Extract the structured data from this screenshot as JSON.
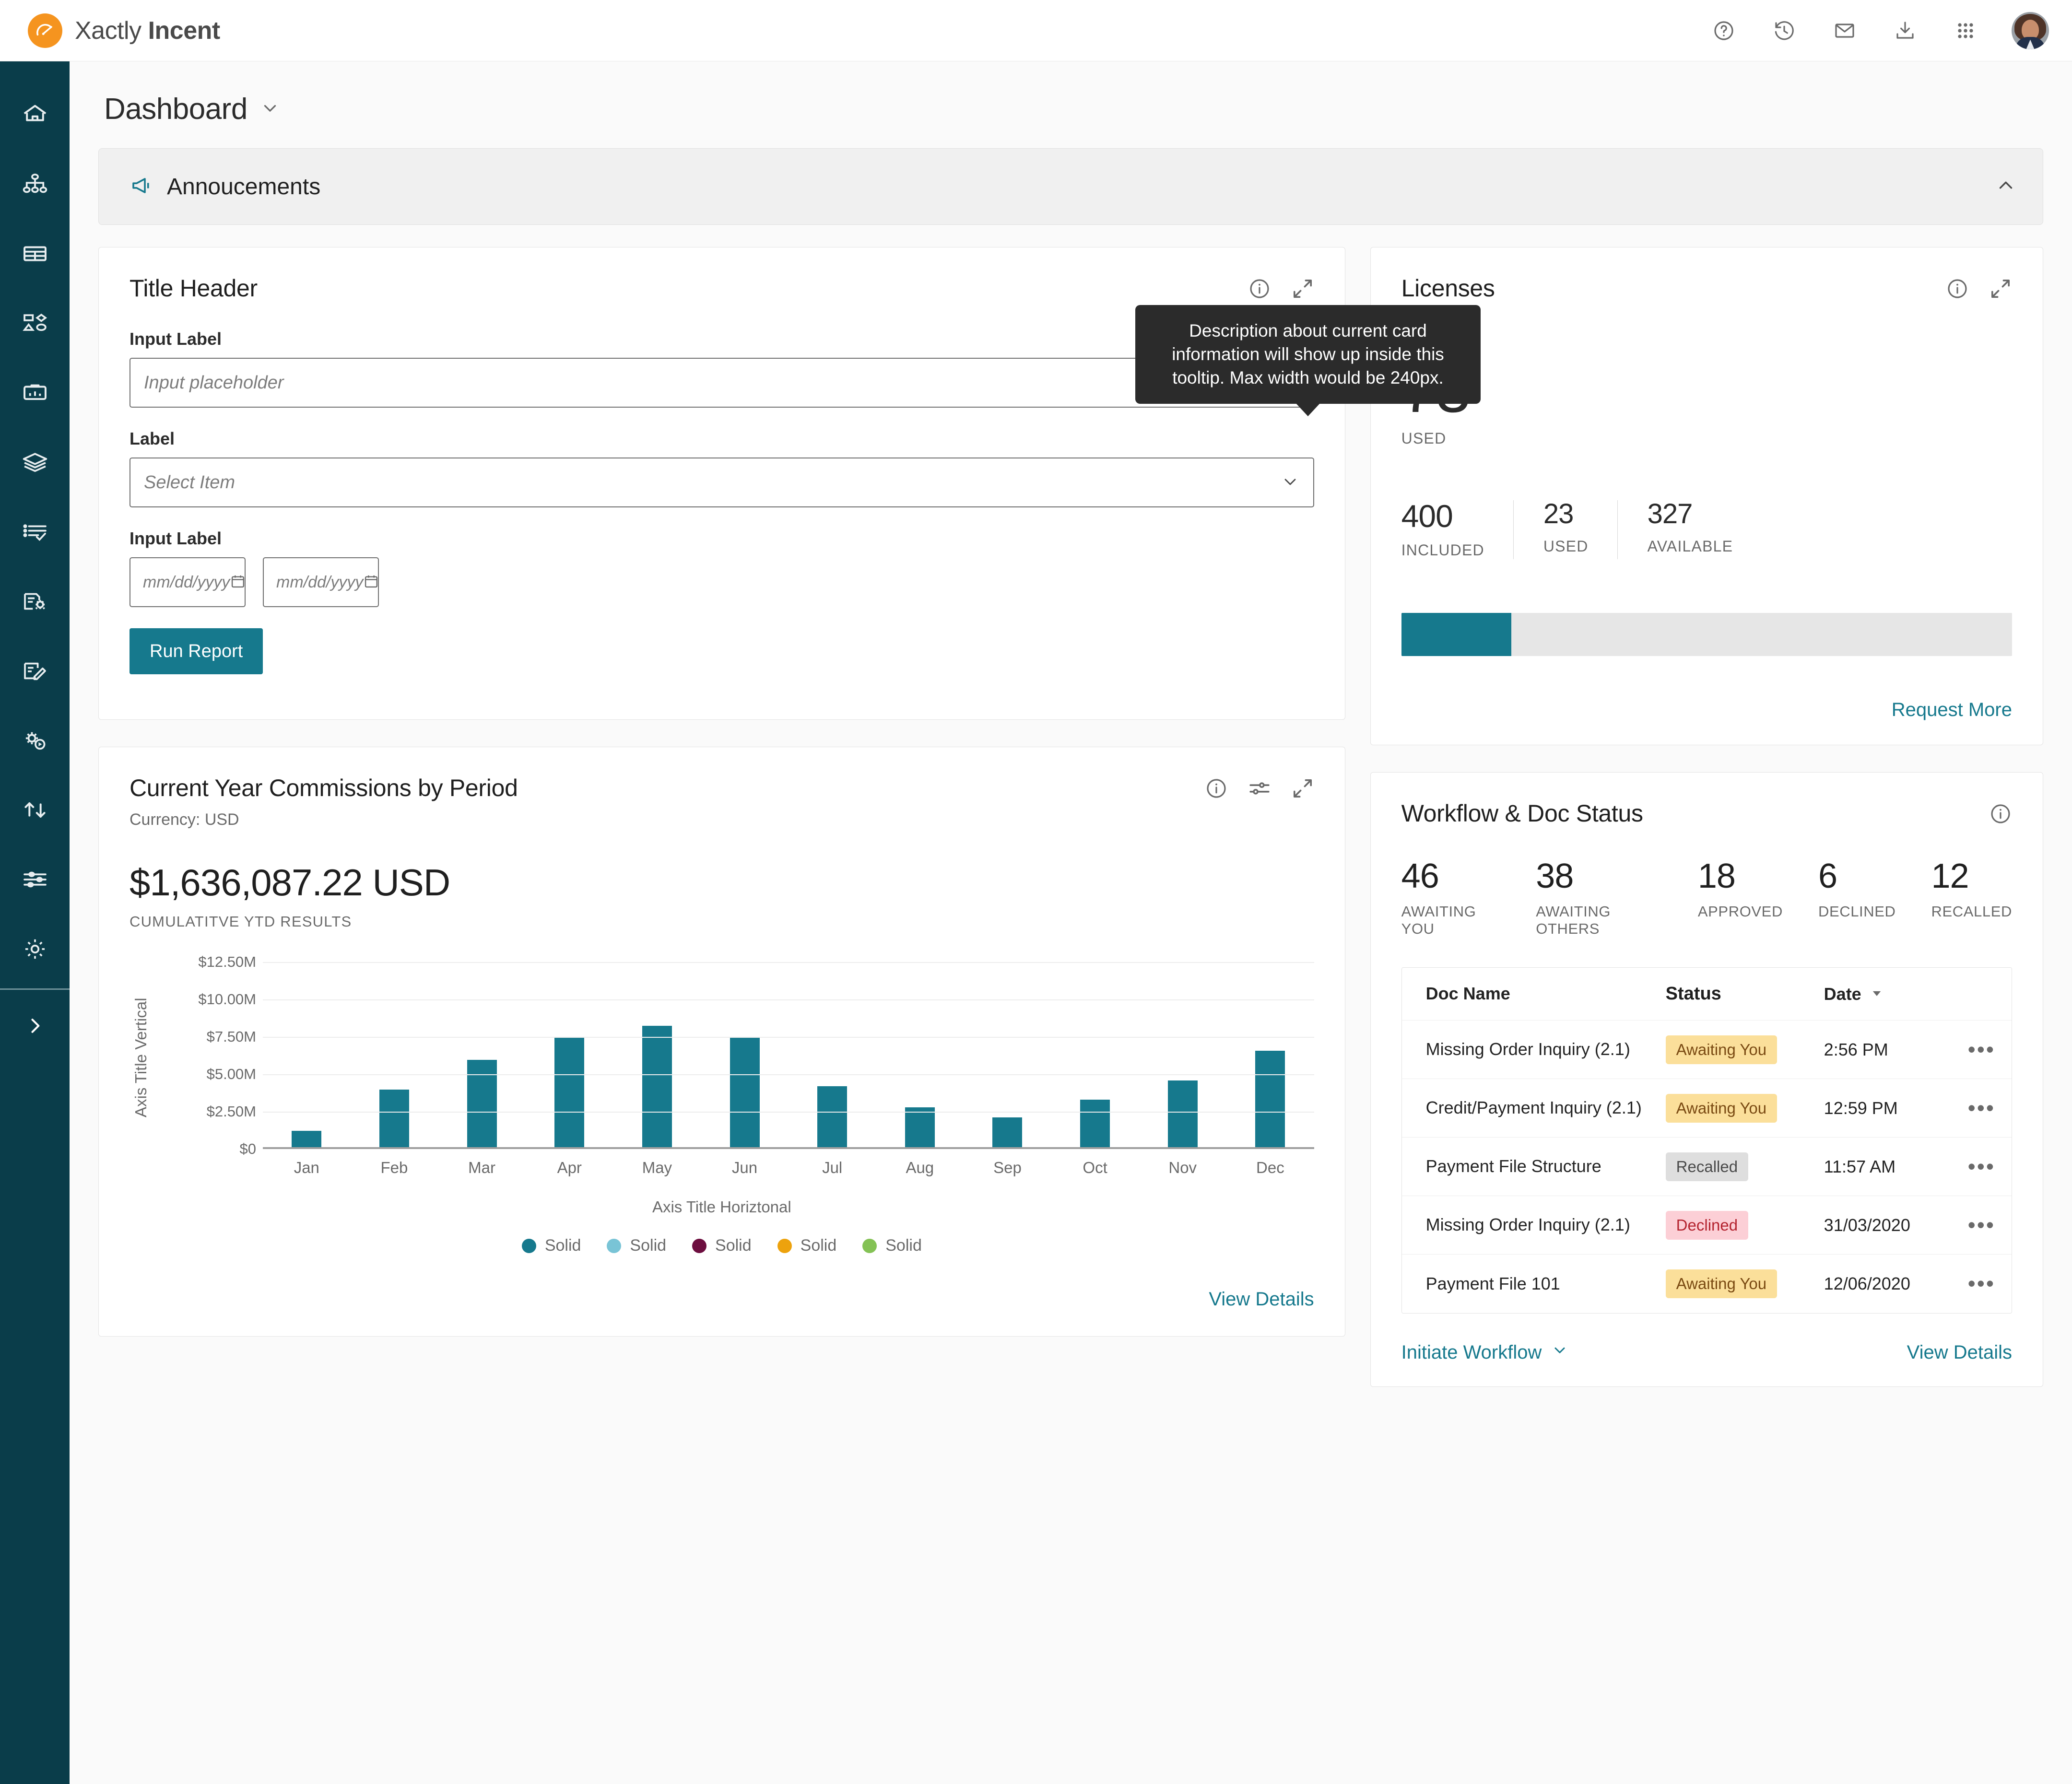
{
  "app": {
    "brand_prefix": "Xactly ",
    "brand_bold": "Incent",
    "logo_icon": "speedometer-icon"
  },
  "topbar": {
    "icons": [
      {
        "name": "help-icon",
        "label": "Help"
      },
      {
        "name": "history-icon",
        "label": "History"
      },
      {
        "name": "mail-icon",
        "label": "Messages"
      },
      {
        "name": "download-icon",
        "label": "Downloads"
      },
      {
        "name": "app-grid-icon",
        "label": "Apps"
      }
    ],
    "avatar_alt": "User avatar"
  },
  "sidebar": {
    "items": [
      {
        "icon": "home-icon",
        "label": "Home"
      },
      {
        "icon": "org-hierarchy-icon",
        "label": "Organization"
      },
      {
        "icon": "table-icon",
        "label": "Tables"
      },
      {
        "icon": "shapes-icon",
        "label": "Plans"
      },
      {
        "icon": "briefcase-chart-icon",
        "label": "Reports"
      },
      {
        "icon": "layers-icon",
        "label": "Layers"
      },
      {
        "icon": "checklist-icon",
        "label": "Checklist"
      },
      {
        "icon": "document-settings-icon",
        "label": "Document Settings"
      },
      {
        "icon": "document-edit-icon",
        "label": "Document Edit"
      },
      {
        "icon": "gear-play-icon",
        "label": "Processes"
      },
      {
        "icon": "transfer-arrows-icon",
        "label": "Transfers"
      },
      {
        "icon": "sliders-icon",
        "label": "Preferences"
      },
      {
        "icon": "gear-icon",
        "label": "Settings"
      }
    ],
    "expand_icon": "chevron-right-icon"
  },
  "page": {
    "title": "Dashboard",
    "title_chevron": "chevron-down-icon"
  },
  "announcements": {
    "icon": "megaphone-icon",
    "label": "Annoucements",
    "collapse_icon": "chevron-up-icon"
  },
  "tooltip": {
    "text": "Description about current card information will show up inside this tooltip. Max width would be 240px."
  },
  "title_card": {
    "title": "Title Header",
    "info_icon": "info-icon",
    "expand_icon": "expand-icon",
    "field1": {
      "label": "Input Label",
      "placeholder": "Input placeholder",
      "value": ""
    },
    "field2": {
      "label": "Label",
      "placeholder": "Select Item",
      "value": "",
      "chevron": "chevron-down-icon"
    },
    "field3": {
      "label": "Input Label",
      "start_placeholder": "mm/dd/yyyy",
      "end_placeholder": "mm/dd/yyyy",
      "calendar_icon": "calendar-icon"
    },
    "submit_label": "Run Report"
  },
  "licenses": {
    "title": "Licenses",
    "info_icon": "info-icon",
    "expand_icon": "expand-icon",
    "headline_value": "73",
    "headline_caption": "USED",
    "stats": [
      {
        "value": "400",
        "caption": "INCLUDED"
      },
      {
        "value": "23",
        "caption": "USED"
      },
      {
        "value": "327",
        "caption": "AVAILABLE"
      }
    ],
    "progress_percent": 18,
    "link_label": "Request More",
    "accent_color": "#16798d"
  },
  "commissions": {
    "title": "Current Year Commissions by Period",
    "subtitle": "Currency: USD",
    "info_icon": "info-icon",
    "settings_icon": "sliders-icon",
    "expand_icon": "expand-icon",
    "kpi_value": "$1,636,087.22 USD",
    "kpi_caption": "CUMULATITVE YTD RESULTS",
    "link_label": "View Details"
  },
  "chart_data": {
    "type": "bar",
    "title": "Current Year Commissions by Period",
    "subtitle": "Currency: USD",
    "xlabel": "Axis Title Horiztonal",
    "ylabel": "Axis Title Vertical",
    "categories": [
      "Jan",
      "Feb",
      "Mar",
      "Apr",
      "May",
      "Jun",
      "Jul",
      "Aug",
      "Sep",
      "Oct",
      "Nov",
      "Dec"
    ],
    "values": [
      1.1,
      3.9,
      5.9,
      7.4,
      8.2,
      7.4,
      4.1,
      2.7,
      2.0,
      3.2,
      4.5,
      6.5
    ],
    "value_unit": "M USD",
    "ylim": [
      0,
      12.5
    ],
    "yticks": [
      0,
      2.5,
      5,
      7.5,
      10,
      12.5
    ],
    "ytick_labels": [
      "$0",
      "$2.50M",
      "$5.00M",
      "$7.50M",
      "$10.00M",
      "$12.50M"
    ],
    "series_color": "#16798d",
    "grid": true,
    "legend_position": "bottom",
    "legend": [
      {
        "label": "Solid",
        "color": "#16798d"
      },
      {
        "label": "Solid",
        "color": "#79c4d6"
      },
      {
        "label": "Solid",
        "color": "#6d0e3f"
      },
      {
        "label": "Solid",
        "color": "#eda20d"
      },
      {
        "label": "Solid",
        "color": "#84c255"
      }
    ]
  },
  "workflow": {
    "title": "Workflow & Doc Status",
    "info_icon": "info-icon",
    "stats": [
      {
        "value": "46",
        "caption": "AWAITING YOU"
      },
      {
        "value": "38",
        "caption": "AWAITING OTHERS"
      },
      {
        "value": "18",
        "caption": "APPROVED"
      },
      {
        "value": "6",
        "caption": "DECLINED"
      },
      {
        "value": "12",
        "caption": "RECALLED"
      }
    ],
    "table": {
      "columns": [
        "Doc Name",
        "Status",
        "Date"
      ],
      "sort_icon": "sort-desc-icon",
      "rows": [
        {
          "name": "Missing Order Inquiry (2.1)",
          "status": "Awaiting You",
          "status_kind": "awaiting",
          "date": "2:56 PM",
          "more_icon": "more-icon"
        },
        {
          "name": "Credit/Payment Inquiry (2.1)",
          "status": "Awaiting You",
          "status_kind": "awaiting",
          "date": "12:59 PM",
          "more_icon": "more-icon"
        },
        {
          "name": "Payment File Structure",
          "status": "Recalled",
          "status_kind": "recalled",
          "date": "11:57 AM",
          "more_icon": "more-icon"
        },
        {
          "name": "Missing Order Inquiry (2.1)",
          "status": "Declined",
          "status_kind": "declined",
          "date": "31/03/2020",
          "more_icon": "more-icon"
        },
        {
          "name": "Payment File 101",
          "status": "Awaiting You",
          "status_kind": "awaiting",
          "date": "12/06/2020",
          "more_icon": "more-icon"
        }
      ]
    },
    "initiate_label": "Initiate Workflow",
    "initiate_chevron": "chevron-down-icon",
    "link_label": "View Details"
  },
  "colors": {
    "sidebar_bg": "#0a3d4a",
    "brand_orange": "#f5941f",
    "accent_teal": "#16798d"
  }
}
